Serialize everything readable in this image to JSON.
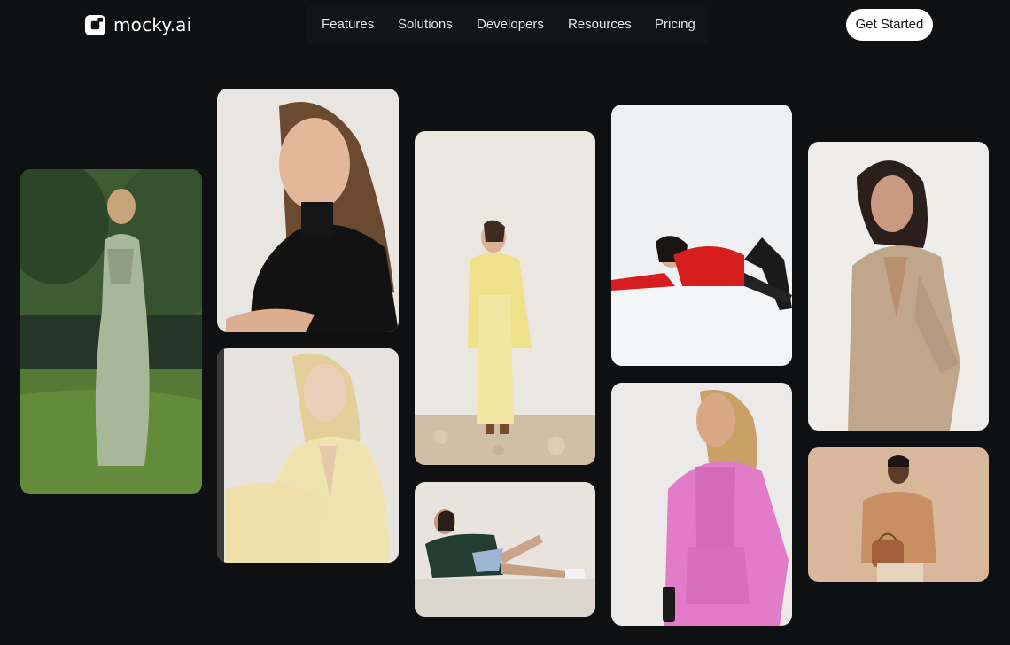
{
  "brand": {
    "name": "mocky.ai",
    "logo_icon": "mocky-logo-icon"
  },
  "nav": {
    "items": [
      {
        "label": "Features"
      },
      {
        "label": "Solutions"
      },
      {
        "label": "Developers"
      },
      {
        "label": "Resources"
      },
      {
        "label": "Pricing"
      }
    ]
  },
  "cta": {
    "label": "Get Started"
  },
  "theme": {
    "background": "#0e1012",
    "text": "#ffffff",
    "button_bg": "#ffffff",
    "button_text": "#111418"
  },
  "gallery": {
    "images": [
      {
        "name": "model-green-satin-dress"
      },
      {
        "name": "model-black-turtleneck"
      },
      {
        "name": "model-cream-suit"
      },
      {
        "name": "model-yellow-coat"
      },
      {
        "name": "model-green-jacket-sitting"
      },
      {
        "name": "model-red-sweater-reclining"
      },
      {
        "name": "model-pink-blazer"
      },
      {
        "name": "model-taupe-suit"
      },
      {
        "name": "model-knit-sweater"
      }
    ]
  }
}
